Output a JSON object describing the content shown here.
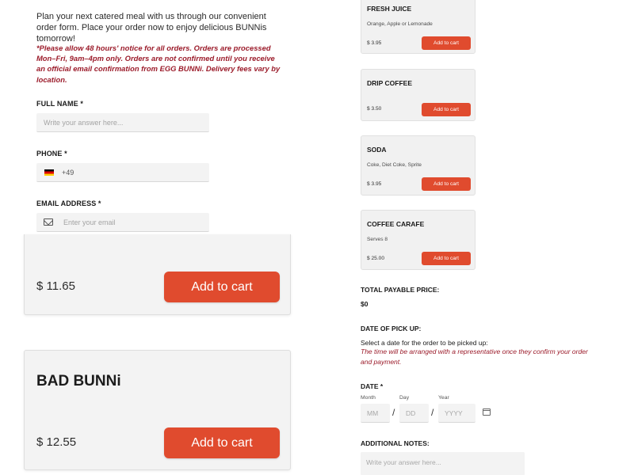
{
  "form": {
    "intro": "Plan your next catered meal with us through our convenient order form. Place your order now to enjoy delicious BUNNis tomorrow!",
    "notice": "*Please allow 48 hours' notice for all orders. Orders are processed Mon–Fri, 9am–4pm only. Orders are not confirmed until you receive an official email confirmation from EGG BUNNi. Delivery fees vary by location.",
    "full_name": {
      "label": "FULL NAME *",
      "placeholder": "Write your answer here..."
    },
    "phone": {
      "label": "PHONE *",
      "country_code": "+49",
      "flag": "germany-flag-icon"
    },
    "email": {
      "label": "EMAIL ADDRESS *",
      "placeholder": "Enter your email",
      "icon": "mail-icon"
    }
  },
  "large_items": [
    {
      "name": "",
      "price": "$ 11.65",
      "button": "Add to cart"
    },
    {
      "name": "BAD BUNNi",
      "price": "$ 12.55",
      "button": "Add to cart"
    }
  ],
  "drinks": [
    {
      "name": "FRESH JUICE",
      "desc": "Orange, Apple or Lemonade",
      "price": "$ 3.95",
      "button": "Add to cart"
    },
    {
      "name": "DRIP COFFEE",
      "desc": "",
      "price": "$ 3.50",
      "button": "Add to cart"
    },
    {
      "name": "SODA",
      "desc": "Coke, Diet Coke, Sprite",
      "price": "$ 3.95",
      "button": "Add to cart"
    },
    {
      "name": "COFFEE CARAFE",
      "desc": "Serves 8",
      "price": "$ 25.00",
      "button": "Add to cart"
    }
  ],
  "total": {
    "label": "TOTAL PAYABLE PRICE:",
    "value": "$0"
  },
  "pickup": {
    "label": "DATE OF PICK UP:",
    "instruction": "Select a date for the order to be picked up:",
    "note": "The time will be arranged with a representative once they confirm your order and payment.",
    "date_label": "DATE *",
    "month_label": "Month",
    "day_label": "Day",
    "year_label": "Year",
    "month_ph": "MM",
    "day_ph": "DD",
    "year_ph": "YYYY",
    "separator": "/",
    "icon": "calendar-icon"
  },
  "notes": {
    "label": "ADDITIONAL NOTES:",
    "placeholder": "Write your answer here..."
  },
  "colors": {
    "accent": "#e04b2e",
    "notice_red": "#9b1b2a",
    "card_bg": "#f3f3f3"
  }
}
